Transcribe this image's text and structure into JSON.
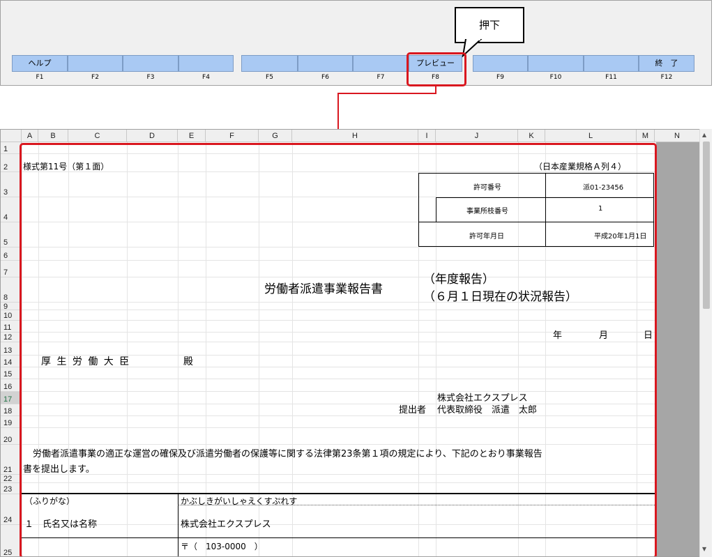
{
  "callout": {
    "label": "押下"
  },
  "function_keys": [
    {
      "label": "ヘルプ",
      "key": "F1"
    },
    {
      "label": "",
      "key": "F2"
    },
    {
      "label": "",
      "key": "F3"
    },
    {
      "label": "",
      "key": "F4"
    },
    {
      "label": "",
      "key": "F5"
    },
    {
      "label": "",
      "key": "F6"
    },
    {
      "label": "",
      "key": "F7"
    },
    {
      "label": "プレビュー",
      "key": "F8"
    },
    {
      "label": "",
      "key": "F9"
    },
    {
      "label": "",
      "key": "F10"
    },
    {
      "label": "",
      "key": "F11"
    },
    {
      "label": "終　了",
      "key": "F12"
    }
  ],
  "sheet": {
    "columns": [
      "A",
      "B",
      "C",
      "D",
      "E",
      "F",
      "G",
      "H",
      "I",
      "J",
      "K",
      "L",
      "M",
      "N"
    ],
    "rows": [
      "1",
      "2",
      "3",
      "4",
      "5",
      "6",
      "7",
      "8",
      "9",
      "10",
      "11",
      "12",
      "13",
      "14",
      "15",
      "16",
      "17",
      "18",
      "19",
      "20",
      "21",
      "22",
      "23",
      "24",
      "25"
    ],
    "form_number": "様式第11号（第１面）",
    "paper_size": "（日本産業規格Ａ列４）",
    "permit": {
      "number_label": "許可番号",
      "number_value": "派01-23456",
      "branch_label": "事業所枝番号",
      "branch_value": "1",
      "date_label": "許可年月日",
      "date_value": "平成20年1月1日"
    },
    "title": "労働者派遣事業報告書",
    "title_sub1": "（年度報告）",
    "title_sub2": "（６月１日現在の状況報告）",
    "date_year": "年",
    "date_month": "月",
    "date_day": "日",
    "addressee": "厚 生 労 働 大 臣",
    "addressee_suffix": "殿",
    "company_name": "株式会社エクスプレス",
    "submitter_label": "提出者",
    "submitter_name": "代表取締役　派遣　太郎",
    "body_line1": "労働者派遣事業の適正な運営の確保及び派遣労働者の保護等に関する法律第23条第１項の規定により、下記のとおり事業報告",
    "body_line2": "書を提出します。",
    "furigana_label": "（ふりがな）",
    "furigana_value": "かぶしきがいしゃえくすぷれす",
    "name_label": "１　氏名又は名称",
    "name_value": "株式会社エクスプレス",
    "postal": "〒（　103-0000　）"
  }
}
